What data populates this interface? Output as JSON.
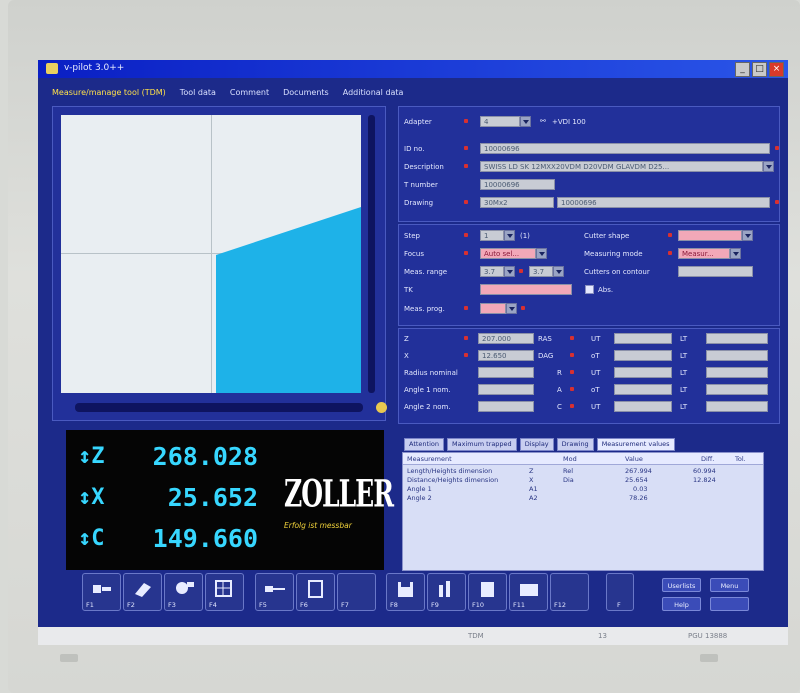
{
  "window": {
    "title": "v-pilot 3.0++"
  },
  "tabs": [
    {
      "label": "Measure/manage tool (TDM)",
      "active": true
    },
    {
      "label": "Tool data",
      "active": false
    },
    {
      "label": "Comment",
      "active": false
    },
    {
      "label": "Documents",
      "active": false
    },
    {
      "label": "Additional data",
      "active": false
    }
  ],
  "form": {
    "adapter_label": "Adapter",
    "adapter_value": "4",
    "link_label": "+VDI 100",
    "id_label": "ID no.",
    "id_value": "10000696",
    "description_label": "Description",
    "description_value": "SWISS LD SK 12MXX20VDM D20VDM GLAVDM D25...",
    "tnumber_label": "T number",
    "tnumber_value": "10000696",
    "drawing_label": "Drawing",
    "drawing_value1": "30Mx2",
    "drawing_value2": "10000696",
    "step_label": "Step",
    "step_value": "1",
    "step_suffix": "(1)",
    "focus_label": "Focus",
    "focus_value": "Auto sel...",
    "meas_range_label": "Meas. range",
    "meas_range_from": "3.7",
    "meas_range_to": "3.7",
    "tk_label": "TK",
    "meas_prog_label": "Meas. prog.",
    "cutter_shape_label": "Cutter shape",
    "measuring_mode_label": "Measuring mode",
    "measuring_mode_value": "Measur...",
    "cutters_label": "Cutters on contour",
    "abs_label": "Abs."
  },
  "values": {
    "z_label": "Z",
    "z_value": "207.000",
    "x_label": "X",
    "x_value": "12.650",
    "radius_label": "Radius nominal",
    "angle1_label": "Angle 1 nom.",
    "angle2_label": "Angle 2 nom.",
    "dz_label": "RAS",
    "dx_label": "DAG",
    "r_label": "R",
    "a_label": "A",
    "c_label": "C",
    "tol_labels": [
      "UT",
      "oT",
      "UT",
      "oT",
      "UT",
      "oT"
    ],
    "lt_label": "LT"
  },
  "dro": {
    "z_axis": "Z",
    "z_value": "268.028",
    "x_axis": "X",
    "x_value": "25.652",
    "c_axis": "C",
    "c_value": "149.660",
    "logo": "ZOLLER",
    "slogan": "Erfolg ist messbar"
  },
  "results": {
    "tabs": [
      {
        "label": "Attention",
        "active": false
      },
      {
        "label": "Maximum trapped",
        "active": false
      },
      {
        "label": "Display",
        "active": false
      },
      {
        "label": "Drawing",
        "active": false
      },
      {
        "label": "Measurement values",
        "active": true
      }
    ],
    "headers": [
      "Measurement",
      "",
      "Mod",
      "Value",
      "Diff.",
      "Tol."
    ],
    "rows": [
      [
        "Length/Heights dimension",
        "Z",
        "Rel",
        "267.994",
        "60.994",
        ""
      ],
      [
        "Distance/Heights dimension",
        "X",
        "Dia",
        "25.654",
        "12.824",
        ""
      ],
      [
        "Angle 1",
        "A1",
        "",
        "0.03",
        "",
        ""
      ],
      [
        "Angle 2",
        "A2",
        "",
        "78.26",
        "",
        ""
      ]
    ]
  },
  "fkeys": [
    "F1",
    "F2",
    "F3",
    "F4",
    "F5",
    "F6",
    "F7",
    "F8",
    "F9",
    "F10",
    "F11",
    "F12",
    "F"
  ],
  "side_buttons": {
    "userlists": "Userlists",
    "menu": "Menu",
    "help": "Help",
    "exit": ""
  },
  "status": {
    "left": "TDM",
    "mid": "13",
    "right": "PGU 13888"
  },
  "colors": {
    "screen_bg": "#1c2a8a",
    "dro_digits": "#37d7ff",
    "logo_tag": "#f1d23a"
  }
}
